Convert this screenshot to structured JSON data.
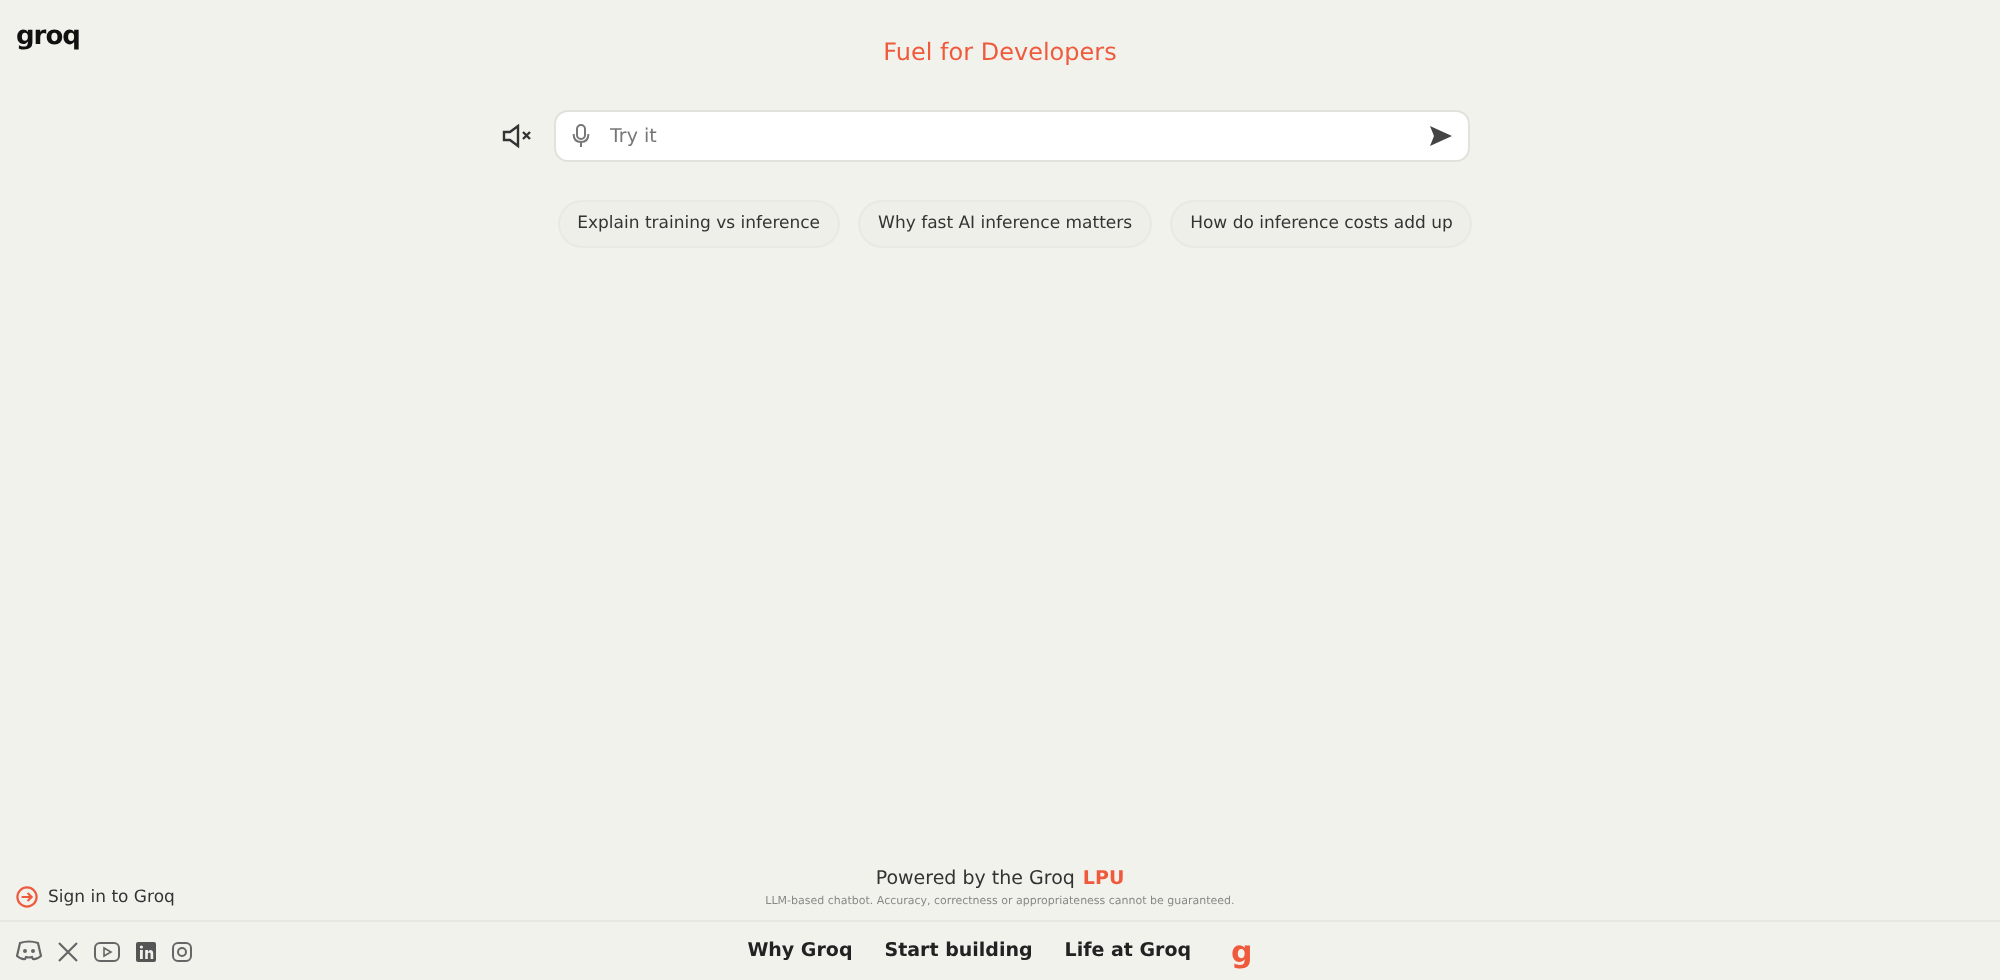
{
  "logo": "groq",
  "headline": "Fuel for Developers",
  "prompt": {
    "placeholder": "Try it",
    "muted": true
  },
  "suggestions": [
    "Explain training vs inference",
    "Why fast AI inference matters",
    "How do inference costs add up"
  ],
  "sign_in": "Sign in to Groq",
  "powered_by": {
    "text": "Powered by the Groq",
    "highlight": "LPU"
  },
  "disclaimer": "LLM-based chatbot. Accuracy, correctness or appropriateness cannot be guaranteed.",
  "social": [
    {
      "kind": "discord"
    },
    {
      "kind": "x"
    },
    {
      "kind": "youtube"
    },
    {
      "kind": "linkedin"
    },
    {
      "kind": "instagram"
    }
  ],
  "footer_links": [
    "Why Groq",
    "Start building",
    "Life at Groq"
  ],
  "footer_mark": "g"
}
